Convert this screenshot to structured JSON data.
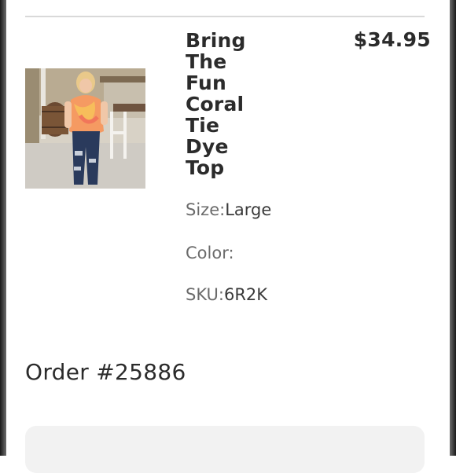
{
  "product": {
    "title_words": [
      "Bring",
      "The",
      "Fun",
      "Coral",
      "Tie",
      "Dye",
      "Top"
    ],
    "price": "$34.95",
    "image_description_icon": "product-photo",
    "attributes": {
      "size_label": "Size:",
      "size_value": "Large",
      "color_label": "Color:",
      "color_value": "",
      "sku_label": "SKU:",
      "sku_value": "6R2K"
    }
  },
  "order": {
    "number_label": "Order #25886"
  },
  "colors": {
    "text": "#2b2b2b",
    "muted": "#6b6b6b",
    "divider": "#d9d9d9",
    "card": "#f2f2f2"
  }
}
